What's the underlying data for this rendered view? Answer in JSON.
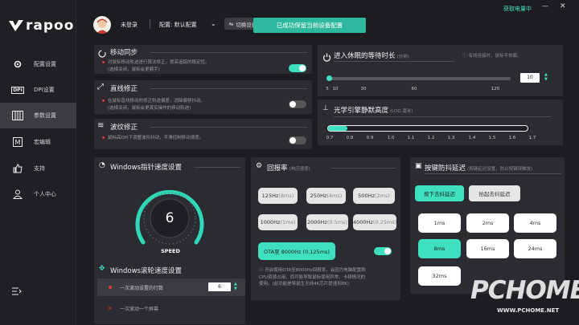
{
  "window": {
    "battery_label": "获取电量中",
    "minimize": "—",
    "close": "✕"
  },
  "logo": {
    "text": "rapoo"
  },
  "sidebar": {
    "items": [
      {
        "label": "配置设置",
        "icon": "gear-icon"
      },
      {
        "label": "DPI设置",
        "icon": "dpi-icon"
      },
      {
        "label": "参数设置",
        "icon": "params-icon",
        "active": true
      },
      {
        "label": "宏编辑",
        "icon": "macro-icon"
      },
      {
        "label": "支持",
        "icon": "thumbs-up-icon"
      },
      {
        "label": "个人中心",
        "icon": "user-icon"
      }
    ],
    "collapse_icon": "collapse-icon"
  },
  "header": {
    "user": "未登录",
    "config_prefix": "配置: 默认配置",
    "switch_device": "切换设备",
    "toast": "已成功保留当前设备配置"
  },
  "motion_sync": {
    "title": "移动同步",
    "desc1": "对鼠标移动轨迹进行算法修正，提高追踪的稳定性。",
    "desc2": "(选择关闭，鼠标会更顺手)",
    "enabled": true
  },
  "line_correction": {
    "title": "直线修正",
    "desc1": "在鼠标直线移动时修正轨迹偏差，消除偏移抖动。",
    "desc2": "(选择关闭，鼠标会更真实操作的移动轨迹)",
    "enabled": false
  },
  "ripple_correction": {
    "title": "波纹修正",
    "desc1": "鼠标高DPI下调整波形抖动，平滑控制移动速度。",
    "enabled": false
  },
  "sleep": {
    "title": "进入休眠的等待时长",
    "unit": "(分钟)",
    "hint": "有线连接时，鼠标不休眠。",
    "value": "10",
    "ticks": [
      "5",
      "10",
      "30",
      "60",
      "120"
    ]
  },
  "lod": {
    "title": "光学引擎静默高度",
    "unit": "(LOD,毫米)",
    "ticks": [
      "0.7",
      "0.8",
      "0.9",
      "1.0",
      "1.1",
      "1.2",
      "1.3",
      "1.4",
      "1.5",
      "1.6",
      "1.7"
    ]
  },
  "windows_speed": {
    "title": "Windows指针速度设置",
    "value": "6",
    "gauge_label": "SPEED"
  },
  "scroll": {
    "title": "Windows滚轮速度设置",
    "option1": "一次滚动设置的行数",
    "option1_value": "6",
    "option2": "一次滚动一个屏幕"
  },
  "report_rate": {
    "title": "回报率",
    "unit": "(响应速度)",
    "options": [
      "125Hz",
      "250Hz",
      "500Hz",
      "1000Hz",
      "2000Hz",
      "4000Hz"
    ],
    "times": [
      "(8ms)",
      "(4ms)",
      "(2ms)",
      "(1ms)",
      "(0.5ms)",
      "(0.25ms)"
    ],
    "ota_label": "OTA至 8000Hz (0.125ms)",
    "ota_enabled": true,
    "note1": "开启使用OTA至8000Hz回报率，会因为电脑配置和",
    "note2": "CPU资源占用，而可能导致鼠标使用异常、卡顿情况的",
    "note3": "使用。(此功能是将鼠生无线4K芯片提速到8K)"
  },
  "debounce": {
    "title": "按键防抖延迟",
    "unit": "(按键延迟设置，防止按键误触发)",
    "tab_press": "按下去抖延迟",
    "tab_release": "抬起去抖延迟",
    "options": [
      "1ms",
      "2ms",
      "4ms",
      "8ms",
      "16ms",
      "24ms",
      "32ms"
    ],
    "selected": "8ms"
  },
  "watermark": {
    "big": "PCHOME",
    "url": "WWW.PCHOME.NET"
  },
  "colors": {
    "accent": "#3ee0c0",
    "bg": "#1c1d21",
    "panel": "#2b2c31"
  }
}
